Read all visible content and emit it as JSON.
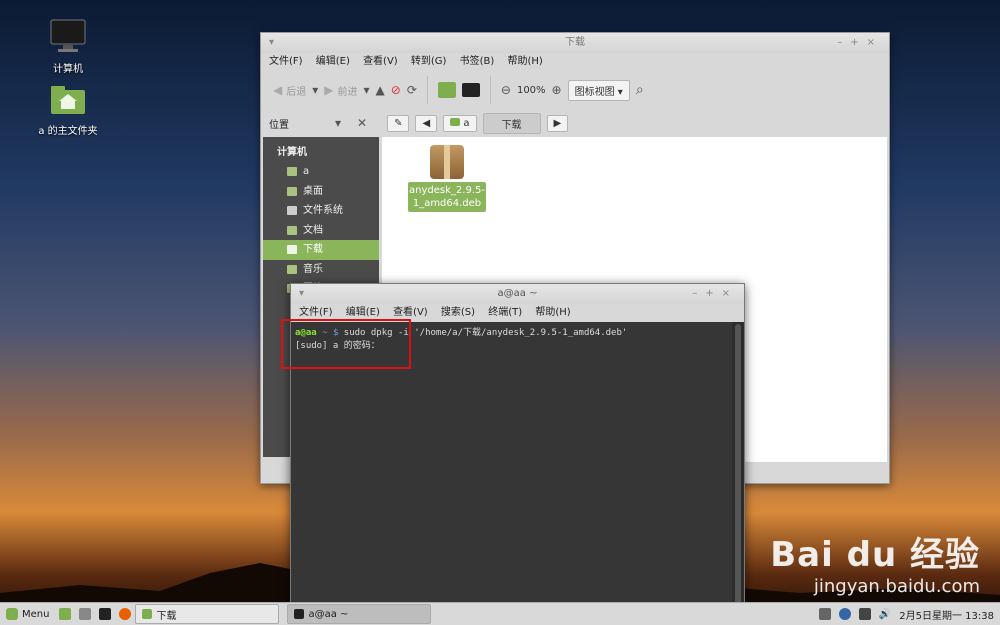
{
  "desktop": {
    "icons": [
      {
        "label": "计算机"
      },
      {
        "label": "a 的主文件夹"
      }
    ]
  },
  "file_manager": {
    "title": "下载",
    "menu": [
      "文件(F)",
      "编辑(E)",
      "查看(V)",
      "转到(G)",
      "书签(B)",
      "帮助(H)"
    ],
    "toolbar": {
      "back": "后退",
      "forward": "前进",
      "zoom": "100%",
      "view": "图标视图"
    },
    "location": {
      "label": "位置",
      "crumbs": [
        "a",
        "下载"
      ]
    },
    "sidebar": {
      "heading": "计算机",
      "items": [
        "a",
        "桌面",
        "文件系统",
        "文档",
        "下载",
        "音乐",
        "图片"
      ]
    },
    "file": {
      "name": "anydesk_2.9.5-1_amd64.deb"
    }
  },
  "terminal": {
    "title": "a@aa ~",
    "menu": [
      "文件(F)",
      "编辑(E)",
      "查看(V)",
      "搜索(S)",
      "终端(T)",
      "帮助(H)"
    ],
    "line1": {
      "prompt": "a@aa",
      "path": "~ $",
      "command": "sudo dpkg -i '/home/a/下载/anydesk_2.9.5-1_amd64.deb'"
    },
    "line2": "[sudo] a 的密码："
  },
  "taskbar": {
    "menu_label": "Menu",
    "windows": [
      "下载",
      "a@aa ~"
    ],
    "clock": "2月5日星期一 13:38"
  },
  "watermark": {
    "brand": "Bai du 经验",
    "url": "jingyan.baidu.com"
  }
}
